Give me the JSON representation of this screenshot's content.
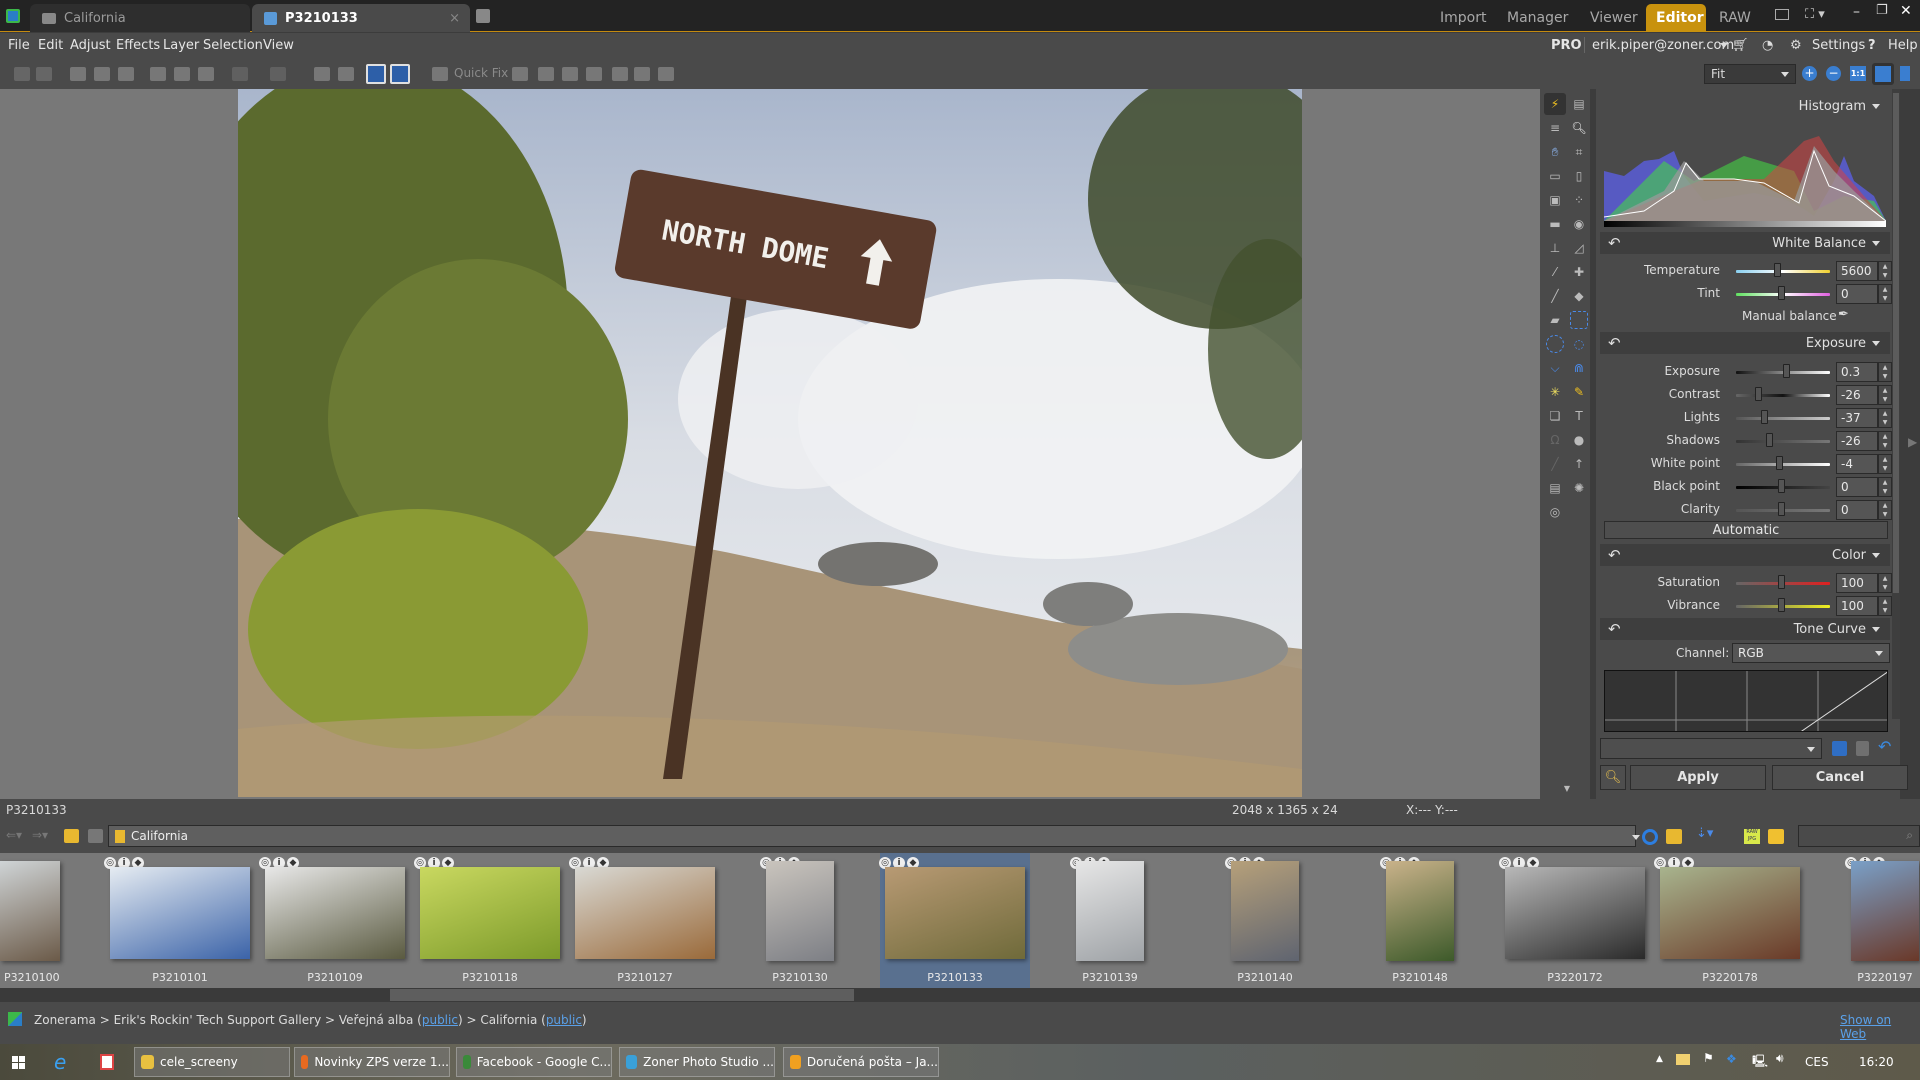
{
  "titlebar": {
    "tabs": [
      {
        "label": "California",
        "icon": "folder-icon",
        "active": false
      },
      {
        "label": "P3210133",
        "icon": "edit-icon",
        "active": true
      }
    ],
    "modes": [
      "Import",
      "Manager",
      "Viewer",
      "Editor",
      "RAW"
    ],
    "active_mode": "Editor"
  },
  "menubar": {
    "items": [
      "File",
      "Edit",
      "Adjust",
      "Effects",
      "Layer",
      "Selection",
      "View"
    ],
    "pro_label": "PRO",
    "account": "erik.piper@zoner.com",
    "settings_label": "Settings",
    "help_label": "Help"
  },
  "toolbar": {
    "quick_fix_label": "Quick Fix",
    "zoom_value": "Fit",
    "one_to_one_label": "1:1"
  },
  "panel": {
    "histogram_title": "Histogram",
    "white_balance": {
      "title": "White Balance",
      "sliders": [
        {
          "label": "Temperature",
          "value": "5600",
          "position": 0.45
        },
        {
          "label": "Tint",
          "value": "0",
          "position": 0.5
        }
      ],
      "manual_balance_label": "Manual balance"
    },
    "exposure": {
      "title": "Exposure",
      "sliders": [
        {
          "label": "Exposure",
          "value": "0.3",
          "position": 0.55
        },
        {
          "label": "Contrast",
          "value": "-26",
          "position": 0.24
        },
        {
          "label": "Lights",
          "value": "-37",
          "position": 0.31
        },
        {
          "label": "Shadows",
          "value": "-26",
          "position": 0.37
        },
        {
          "label": "White point",
          "value": "-4",
          "position": 0.48
        },
        {
          "label": "Black point",
          "value": "0",
          "position": 0.5
        },
        {
          "label": "Clarity",
          "value": "0",
          "position": 0.5
        }
      ],
      "automatic_label": "Automatic"
    },
    "color": {
      "title": "Color",
      "sliders": [
        {
          "label": "Saturation",
          "value": "100",
          "position": 0.5
        },
        {
          "label": "Vibrance",
          "value": "100",
          "position": 0.5
        }
      ]
    },
    "tone_curve": {
      "title": "Tone Curve",
      "channel_label": "Channel:",
      "channel_value": "RGB"
    },
    "preset_value": "",
    "apply_label": "Apply",
    "cancel_label": "Cancel"
  },
  "status": {
    "filename": "P3210133",
    "dimensions": "2048 x 1365 x 24",
    "coords": "X:---  Y:---"
  },
  "navbar": {
    "path": "California",
    "search_placeholder": ""
  },
  "filmstrip": {
    "items": [
      {
        "name": "P3210100",
        "selected": false,
        "colors": [
          "#6b5a48",
          "#cfd4d6"
        ]
      },
      {
        "name": "P3210101",
        "selected": false,
        "colors": [
          "#3b63a8",
          "#e6ecf2"
        ]
      },
      {
        "name": "P3210109",
        "selected": false,
        "colors": [
          "#5a5a40",
          "#e8e8e8"
        ]
      },
      {
        "name": "P3210118",
        "selected": false,
        "colors": [
          "#7c9a2a",
          "#c9d860"
        ]
      },
      {
        "name": "P3210127",
        "selected": false,
        "colors": [
          "#9a6a3a",
          "#d9d9d4"
        ]
      },
      {
        "name": "P3210130",
        "selected": false,
        "colors": [
          "#7d7f85",
          "#c9c4bd"
        ]
      },
      {
        "name": "P3210133",
        "selected": true,
        "colors": [
          "#6f6a3a",
          "#b89a74"
        ]
      },
      {
        "name": "P3210139",
        "selected": false,
        "colors": [
          "#9ea2a6",
          "#e6e6e6"
        ]
      },
      {
        "name": "P3210140",
        "selected": false,
        "colors": [
          "#5f6470",
          "#b6a07a"
        ]
      },
      {
        "name": "P3210148",
        "selected": false,
        "colors": [
          "#3d5a2a",
          "#c9b28a"
        ]
      },
      {
        "name": "P3220172",
        "selected": false,
        "colors": [
          "#2a2a2a",
          "#b8b8b8"
        ]
      },
      {
        "name": "P3220178",
        "selected": false,
        "colors": [
          "#6a3a28",
          "#a8b48e"
        ]
      },
      {
        "name": "P3220197",
        "selected": false,
        "colors": [
          "#6a3828",
          "#7aa0c8"
        ]
      }
    ]
  },
  "zonerama": {
    "root": "Zonerama",
    "gallery": "Erik's Rockin' Tech Support Gallery",
    "albums": "Veřejná alba",
    "album": "California",
    "public_label": "public",
    "show_on_web": "Show on Web"
  },
  "taskbar": {
    "apps": [
      {
        "label": "cele_screeny",
        "icon": "folder-icon"
      },
      {
        "label": "Novinky ZPS verze 1...",
        "icon": "firefox-icon"
      },
      {
        "label": "Facebook - Google C...",
        "icon": "chrome-icon"
      },
      {
        "label": "Zoner Photo Studio ...",
        "icon": "zoner-icon"
      },
      {
        "label": "Doručená pošta – Ja...",
        "icon": "outlook-icon"
      }
    ],
    "language": "CES",
    "time": "16:20"
  },
  "photo": {
    "sign_text": "NORTH DOME"
  }
}
